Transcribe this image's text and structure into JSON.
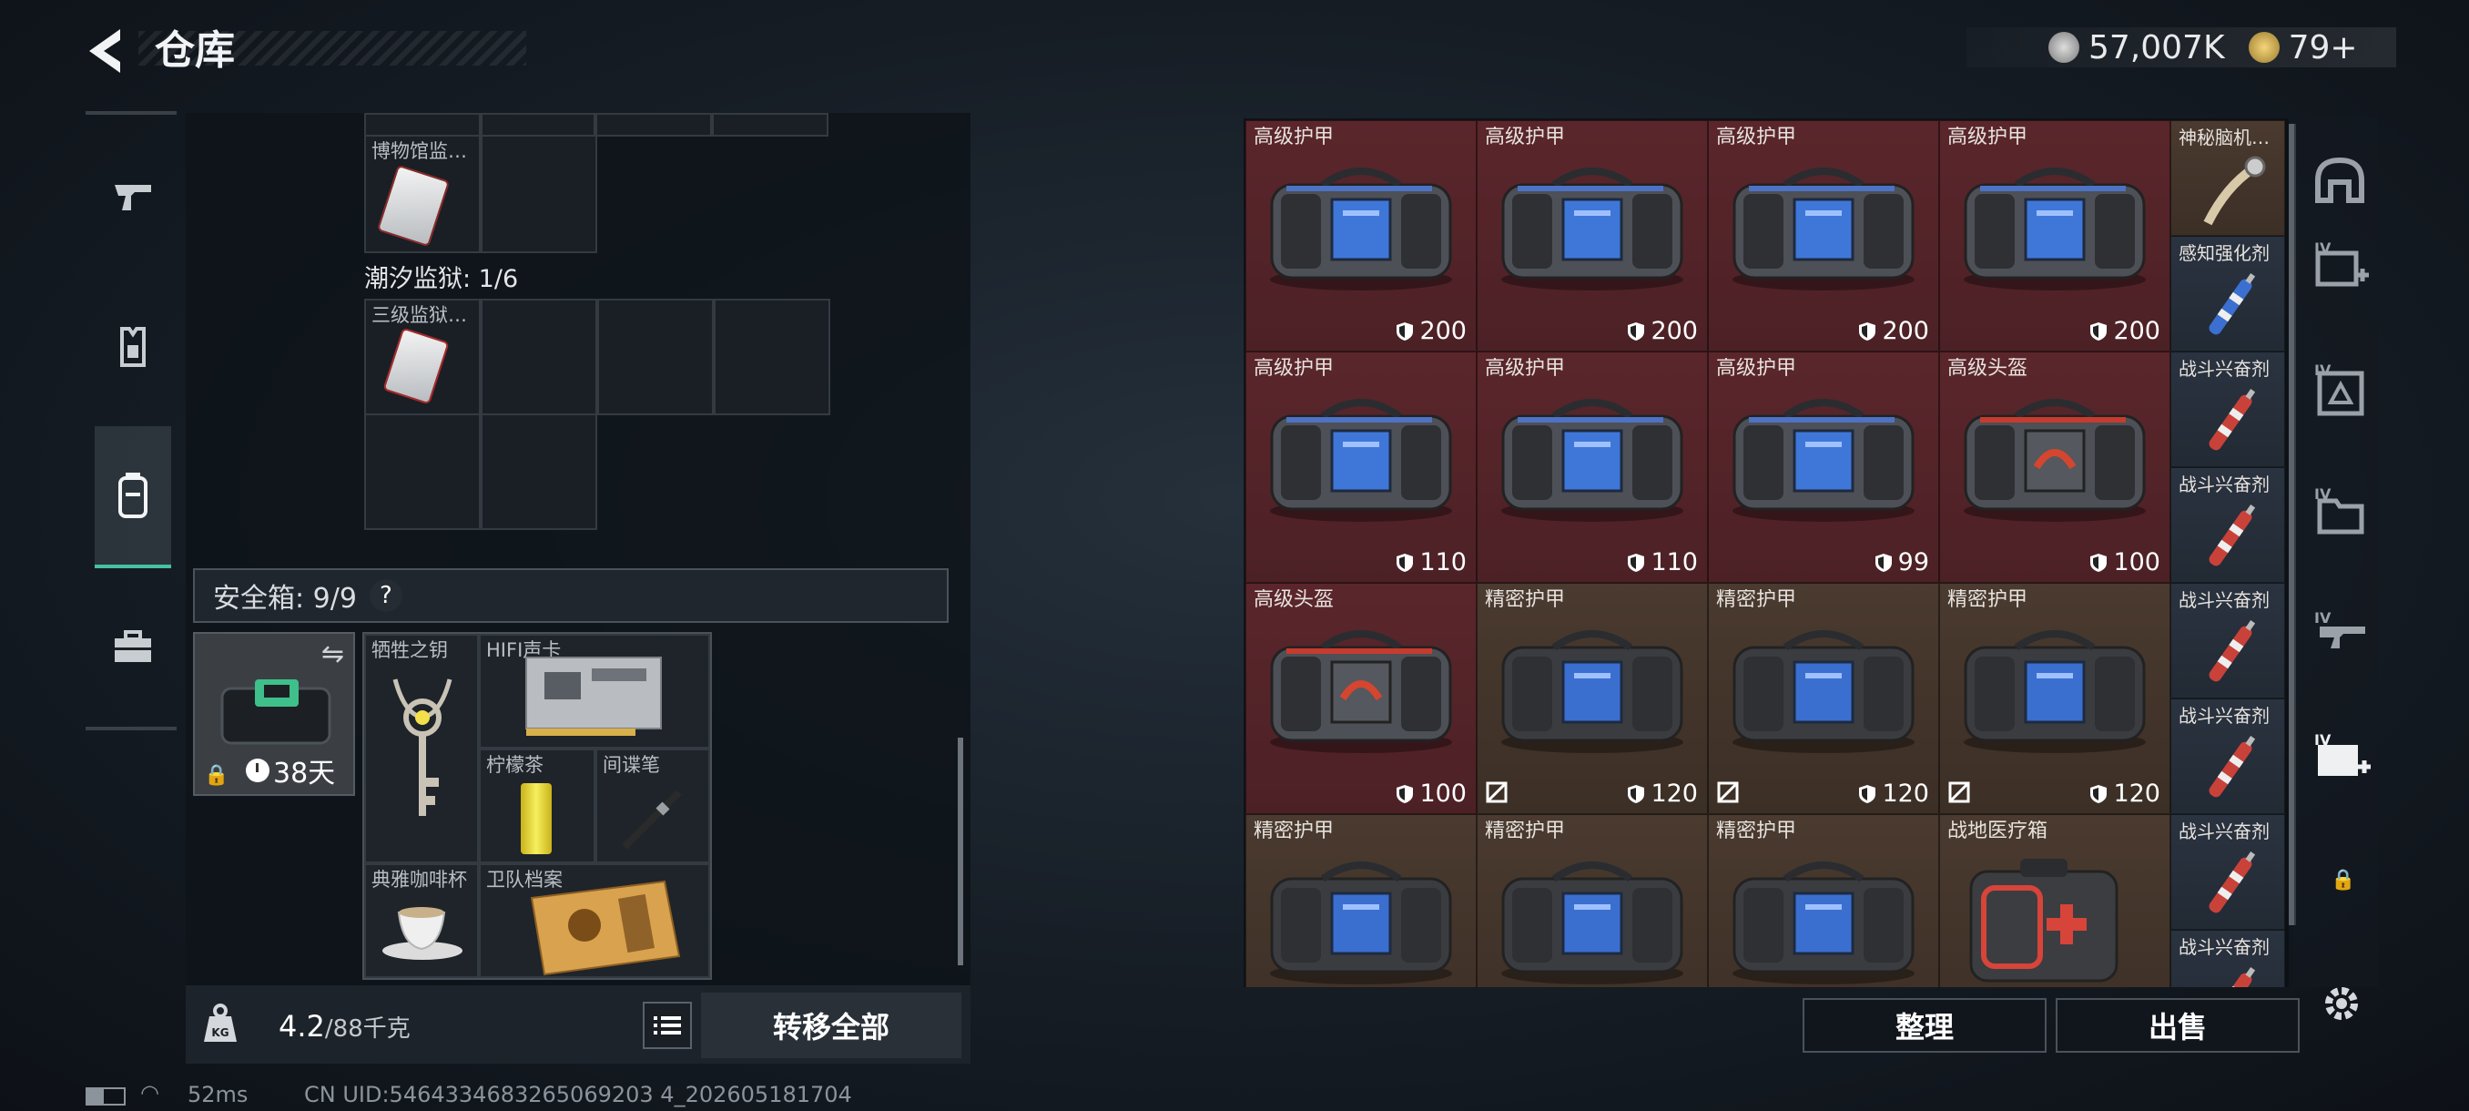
{
  "header": {
    "title": "仓库",
    "currency": "57,007K",
    "tokens": "79+"
  },
  "nav": [
    {
      "id": "weapons"
    },
    {
      "id": "equipment"
    },
    {
      "id": "backpack",
      "active": true
    },
    {
      "id": "toolbox"
    }
  ],
  "stash": {
    "museum_item": "博物馆监…",
    "prison_label": "潮汐监狱: 1/6",
    "prison_item": "三级监狱…",
    "safe_label": "安全箱: 9/9",
    "safe_help": "?",
    "safe_days": "38天",
    "safe_items": [
      {
        "name": "牺牲之钥",
        "icon": "key"
      },
      {
        "name": "HIFI声卡",
        "icon": "sound-card"
      },
      {
        "name": "柠檬茶",
        "icon": "lemon-tea"
      },
      {
        "name": "间谍笔",
        "icon": "spy-pen"
      },
      {
        "name": "典雅咖啡杯",
        "icon": "coffee-cup"
      },
      {
        "name": "卫队档案",
        "icon": "file"
      }
    ],
    "weight": "4.2",
    "weight_max": "/88千克",
    "transfer_all": "转移全部"
  },
  "inventory": {
    "large": [
      {
        "name": "高级护甲",
        "value": "200",
        "kind": "blue-bag",
        "bg": "red"
      },
      {
        "name": "高级护甲",
        "value": "200",
        "kind": "blue-bag",
        "bg": "red"
      },
      {
        "name": "高级护甲",
        "value": "200",
        "kind": "blue-bag",
        "bg": "red"
      },
      {
        "name": "高级护甲",
        "value": "200",
        "kind": "blue-bag",
        "bg": "red"
      },
      {
        "name": "高级护甲",
        "value": "110",
        "kind": "blue-bag",
        "bg": "red"
      },
      {
        "name": "高级护甲",
        "value": "110",
        "kind": "blue-bag",
        "bg": "red"
      },
      {
        "name": "高级护甲",
        "value": "99",
        "kind": "blue-bag",
        "bg": "red"
      },
      {
        "name": "高级头盔",
        "value": "100",
        "kind": "red-bag",
        "bg": "red"
      },
      {
        "name": "高级头盔",
        "value": "100",
        "kind": "red-bag",
        "bg": "red"
      },
      {
        "name": "精密护甲",
        "value": "120",
        "kind": "dark-bag",
        "bg": "brown",
        "broken": true
      },
      {
        "name": "精密护甲",
        "value": "120",
        "kind": "dark-bag",
        "bg": "brown",
        "broken": true
      },
      {
        "name": "精密护甲",
        "value": "120",
        "kind": "dark-bag",
        "bg": "brown",
        "broken": true
      },
      {
        "name": "精密护甲",
        "value": "",
        "kind": "dark-bag",
        "bg": "brown"
      },
      {
        "name": "精密护甲",
        "value": "",
        "kind": "dark-bag",
        "bg": "brown"
      },
      {
        "name": "精密护甲",
        "value": "",
        "kind": "dark-bag",
        "bg": "brown"
      },
      {
        "name": "战地医疗箱",
        "value": "",
        "kind": "medkit",
        "bg": "brown"
      }
    ],
    "narrow": [
      {
        "name": "神秘脑机…",
        "kind": "neural"
      },
      {
        "name": "感知强化剂",
        "kind": "blue-injector"
      },
      {
        "name": "战斗兴奋剂",
        "kind": "red-injector"
      },
      {
        "name": "战斗兴奋剂",
        "kind": "red-injector"
      },
      {
        "name": "战斗兴奋剂",
        "kind": "red-injector"
      },
      {
        "name": "战斗兴奋剂",
        "kind": "red-injector"
      },
      {
        "name": "战斗兴奋剂",
        "kind": "red-injector"
      },
      {
        "name": "战斗兴奋剂",
        "kind": "red-injector"
      }
    ],
    "sort": "整理",
    "sell": "出售"
  },
  "right_nav": [
    "helmet",
    "armor-slot",
    "rig-slot",
    "folder-slot",
    "gun-slot",
    "medkit-slot"
  ],
  "status": {
    "ping": "52ms",
    "uid": "CN UID:5464334683265069203 4_202605181704"
  },
  "colors": {
    "accent": "#46c2a0",
    "red_bg": "#5a262b",
    "brown_bg": "#4a3a2f"
  }
}
